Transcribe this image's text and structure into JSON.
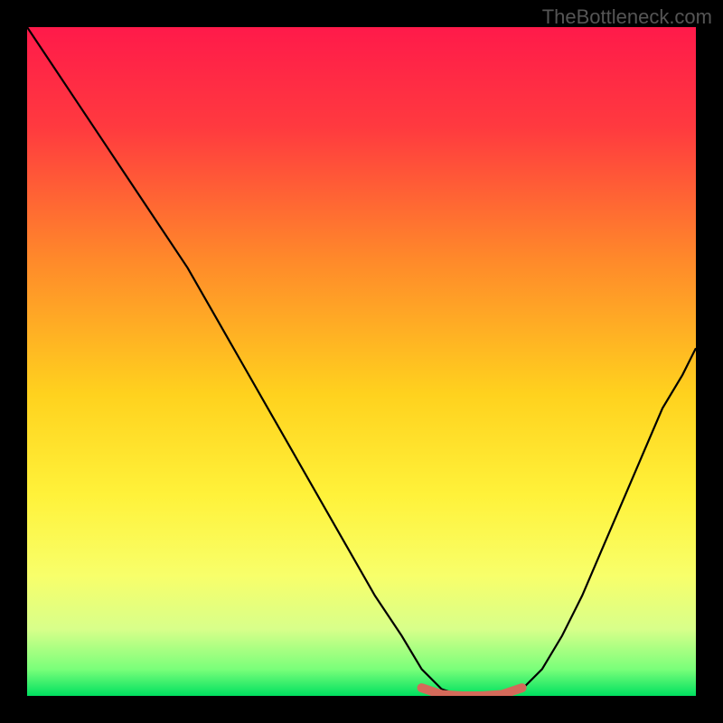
{
  "watermark": "TheBottleneck.com",
  "chart_data": {
    "type": "line",
    "title": "",
    "xlabel": "",
    "ylabel": "",
    "xlim": [
      0,
      100
    ],
    "ylim": [
      0,
      100
    ],
    "background_gradient": {
      "stops": [
        {
          "offset": 0.0,
          "color": "#ff1a4a"
        },
        {
          "offset": 0.15,
          "color": "#ff3a3f"
        },
        {
          "offset": 0.35,
          "color": "#ff8a2a"
        },
        {
          "offset": 0.55,
          "color": "#ffd21e"
        },
        {
          "offset": 0.7,
          "color": "#fff23a"
        },
        {
          "offset": 0.82,
          "color": "#f8ff6a"
        },
        {
          "offset": 0.9,
          "color": "#d8ff8a"
        },
        {
          "offset": 0.96,
          "color": "#7aff7a"
        },
        {
          "offset": 1.0,
          "color": "#00e060"
        }
      ]
    },
    "series": [
      {
        "name": "curve",
        "color": "#000000",
        "width": 2.2,
        "x": [
          0,
          4,
          8,
          12,
          16,
          20,
          24,
          28,
          32,
          36,
          40,
          44,
          48,
          52,
          56,
          59,
          62,
          65,
          68,
          71,
          74,
          77,
          80,
          83,
          86,
          89,
          92,
          95,
          98,
          100
        ],
        "y": [
          100,
          94,
          88,
          82,
          76,
          70,
          64,
          57,
          50,
          43,
          36,
          29,
          22,
          15,
          9,
          4,
          1,
          0,
          0,
          0,
          1,
          4,
          9,
          15,
          22,
          29,
          36,
          43,
          48,
          52
        ]
      },
      {
        "name": "bottom-lobe",
        "color": "#d46a5a",
        "width": 10,
        "linecap": "round",
        "x": [
          59,
          62,
          65,
          68,
          71,
          74
        ],
        "y": [
          1.2,
          0.2,
          0,
          0,
          0.2,
          1.2
        ]
      }
    ]
  }
}
